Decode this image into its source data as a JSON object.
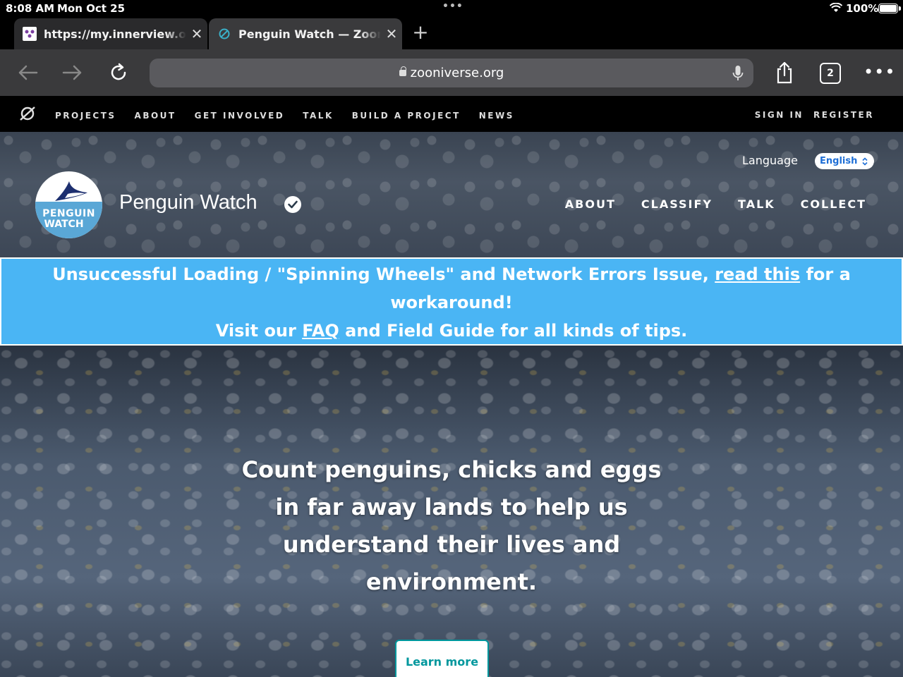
{
  "status_bar": {
    "time": "8:08 AM",
    "date": "Mon Oct 25",
    "battery": "100%"
  },
  "browser": {
    "tabs": [
      {
        "title": "https://my.innerview.org",
        "favicon": "innerview-icon"
      },
      {
        "title": "Penguin Watch — Zooniverse",
        "favicon": "zooniverse-icon"
      }
    ],
    "url": "zooniverse.org",
    "tab_count": "2"
  },
  "zooniverse_nav": {
    "links": [
      "PROJECTS",
      "ABOUT",
      "GET INVOLVED",
      "TALK",
      "BUILD A PROJECT",
      "NEWS"
    ],
    "sign_in": "SIGN IN",
    "register": "REGISTER"
  },
  "project": {
    "logo_text_line1": "PENGUIN",
    "logo_text_line2": "WATCH",
    "title": "Penguin Watch",
    "language_label": "Language",
    "language_value": "English",
    "nav": [
      "ABOUT",
      "CLASSIFY",
      "TALK",
      "COLLECT"
    ]
  },
  "banner": {
    "line1_prefix": "Unsuccessful Loading / \"Spinning Wheels\" and Network Errors Issue, ",
    "line1_link": "read this",
    "line1_suffix": " for a",
    "line2": "workaround!",
    "line3_prefix": "Visit our ",
    "line3_link": "FAQ",
    "line3_suffix": " and Field Guide for all kinds of tips."
  },
  "hero": {
    "lines": [
      "Count penguins, chicks and eggs",
      "in far away lands to help us",
      "understand their lives and",
      "environment."
    ],
    "button": "Learn more"
  },
  "colors": {
    "banner": "#4ab5f4",
    "accent": "#00979d",
    "language_text": "#1f6fd6"
  }
}
